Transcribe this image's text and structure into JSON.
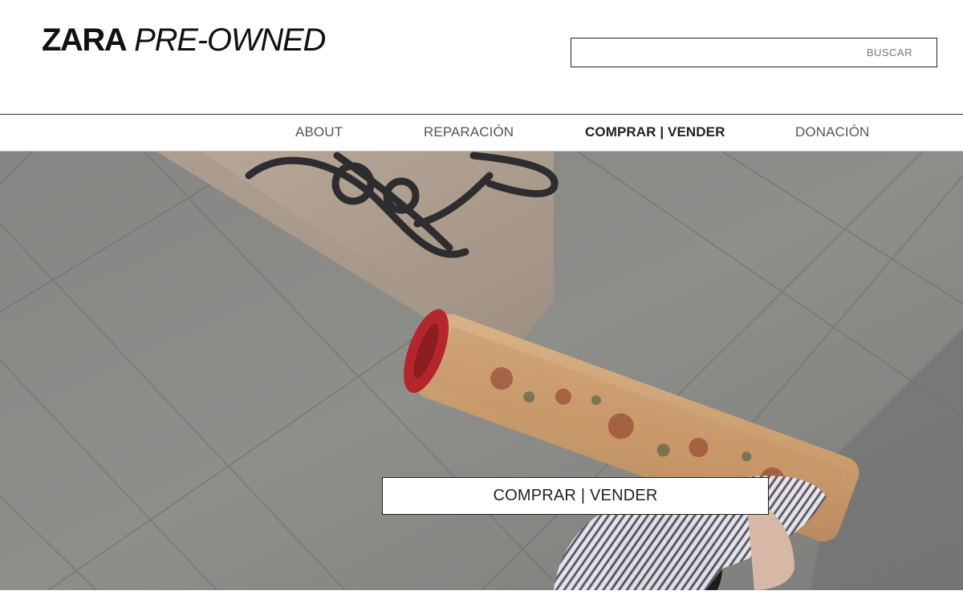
{
  "header": {
    "logo_brand": "ZARA",
    "logo_sub": "PRE-OWNED",
    "search": {
      "value": "",
      "placeholder": "",
      "button_label": "BUSCAR"
    }
  },
  "nav": {
    "items": [
      {
        "label": "ABOUT",
        "active": false
      },
      {
        "label": "REPARACIÓN",
        "active": false
      },
      {
        "label": "COMPRAR | VENDER",
        "active": true
      },
      {
        "label": "DONACIÓN",
        "active": false
      }
    ]
  },
  "hero": {
    "image": "hero-photo-street-person-carrying-rug",
    "cta_label": "COMPRAR | VENDER"
  },
  "colors": {
    "text": "#111111",
    "nav_inactive": "#555555",
    "search_button": "#777777",
    "hero_pavement": "#8a8a87",
    "rug_red": "#b4262b",
    "rug_tan": "#d2a77a"
  }
}
